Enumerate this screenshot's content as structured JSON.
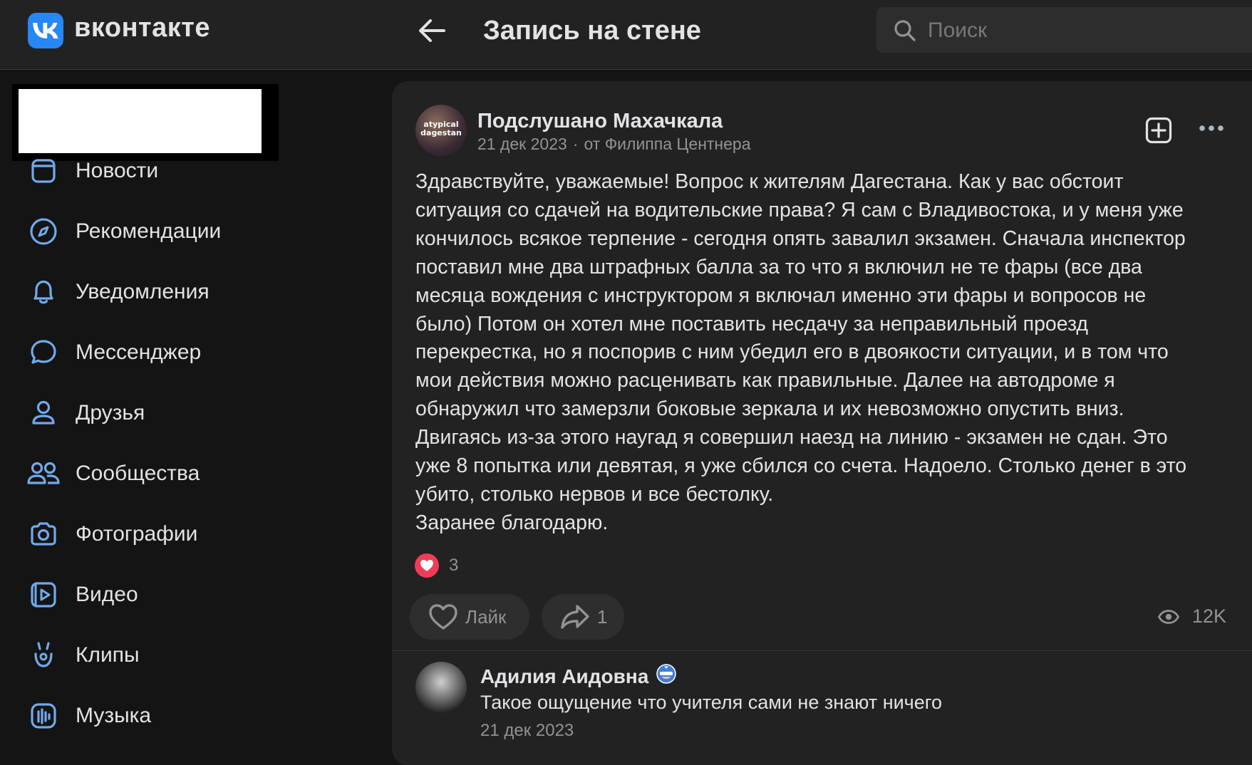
{
  "header": {
    "logo_text": "вконтакте",
    "page_title": "Запись на стене",
    "search_placeholder": "Поиск"
  },
  "sidebar": {
    "items": [
      {
        "label": "Новости",
        "icon": "news-icon"
      },
      {
        "label": "Рекомендации",
        "icon": "compass-icon"
      },
      {
        "label": "Уведомления",
        "icon": "bell-icon"
      },
      {
        "label": "Мессенджер",
        "icon": "chat-icon"
      },
      {
        "label": "Друзья",
        "icon": "user-icon"
      },
      {
        "label": "Сообщества",
        "icon": "users-icon"
      },
      {
        "label": "Фотографии",
        "icon": "camera-icon"
      },
      {
        "label": "Видео",
        "icon": "video-icon"
      },
      {
        "label": "Клипы",
        "icon": "clips-icon"
      },
      {
        "label": "Музыка",
        "icon": "music-icon"
      }
    ]
  },
  "post": {
    "author": "Подслушано Махачкала",
    "avatar_text": "atypical dagestan",
    "date": "21 дек 2023",
    "from": "от Филиппа Центнера",
    "text": "Здравствуйте, уважаемые! Вопрос к жителям Дагестана. Как у вас обстоит\nситуация со сдачей на водительские права? Я сам с Владивостока, и у меня уже\nкончилось всякое терпение - сегодня опять завалил экзамен. Сначала инспектор\nпоставил мне два штрафных балла за то что я включил не те фары (все два\nмесяца вождения с инструктором я включал именно эти фары и вопросов не\nбыло) Потом он хотел мне поставить несдачу за неправильный проезд\nперекрестка, но я поспорив с ним убедил его в двоякости ситуации, и в том что\nмои действия можно расценивать как правильные. Далее на автодроме я\nобнаружил что замерзли боковые зеркала и их невозможно опустить вниз.\nДвигаясь из-за этого наугад я совершил наезд на линию - экзамен не сдан. Это\nуже 8 попытка или девятая, я уже сбился со счета. Надоело. Столько денег в это\nубито, столько нервов и все бестолку.\nЗаранее благодарю.",
    "reactions_count": "3",
    "like_label": "Лайк",
    "share_count": "1",
    "views": "12K"
  },
  "comment": {
    "author": "Адилия Аидовна",
    "text": "Такое ощущение что учителя сами не знают ничего",
    "date": "21 дек 2023"
  },
  "colors": {
    "accent": "#2787f5",
    "icon_blue": "#71aaeb",
    "heart": "#f23c57",
    "background": "#141414",
    "panel": "#222222"
  }
}
